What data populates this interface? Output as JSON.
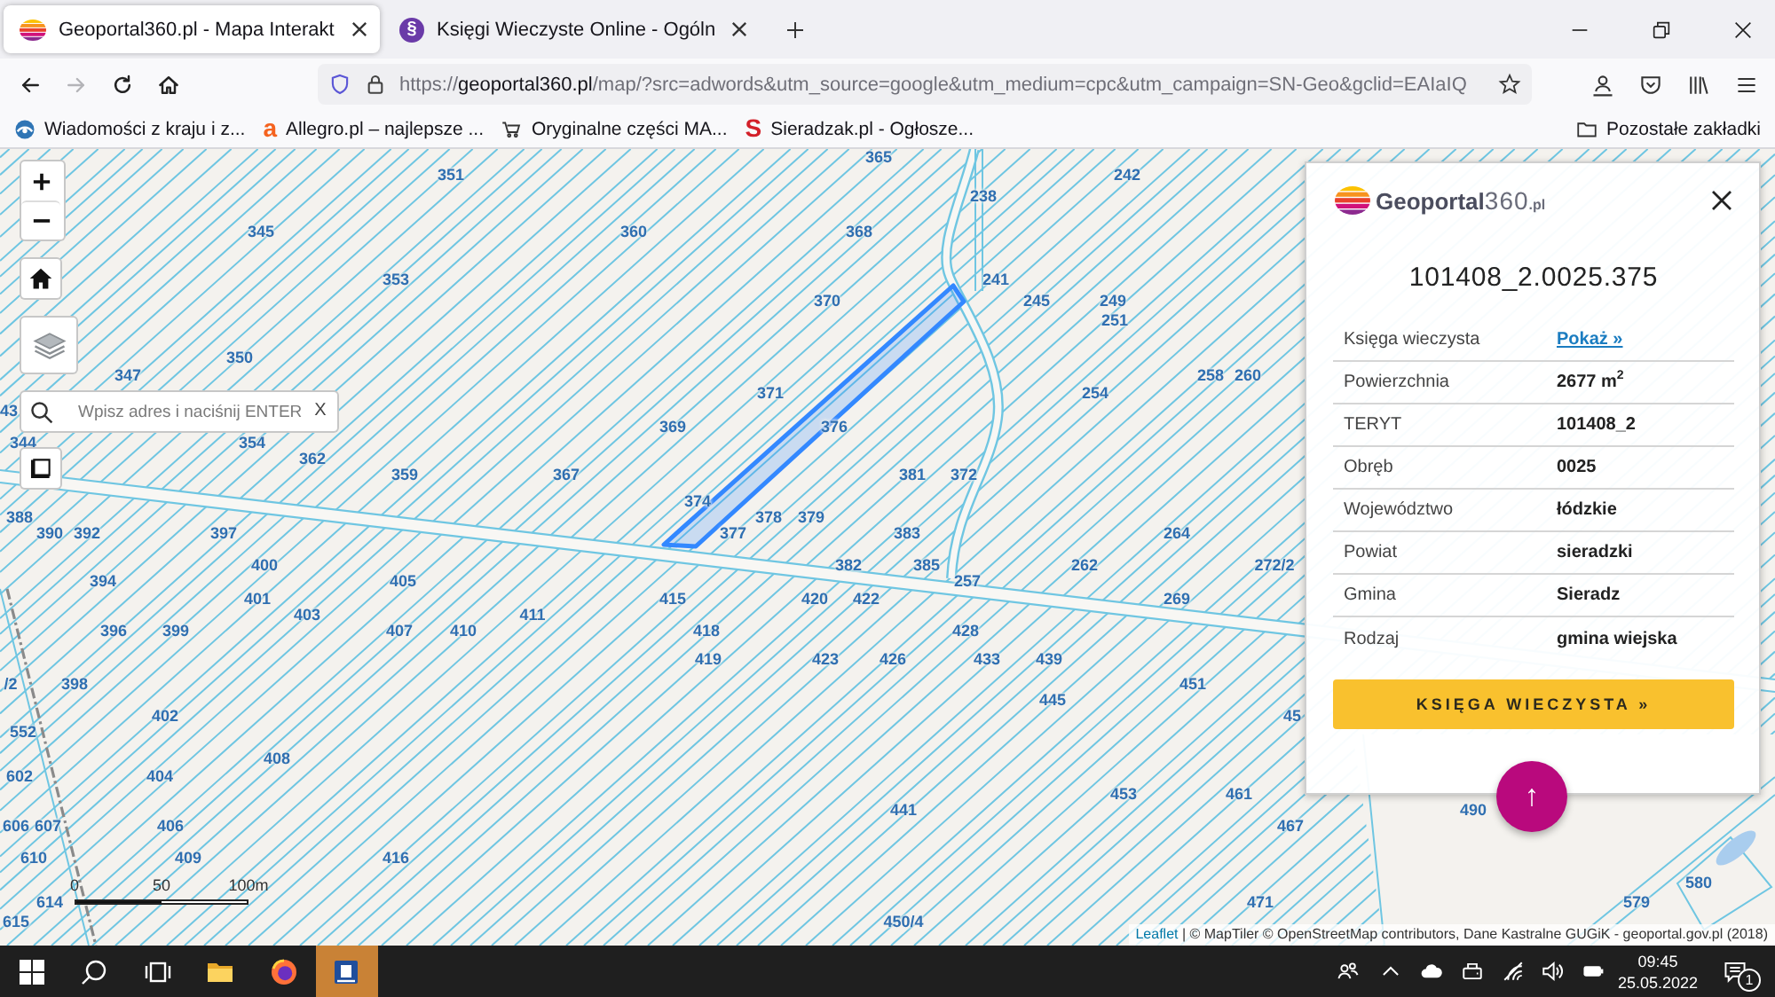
{
  "browser": {
    "tabs": [
      {
        "kind": "stripes",
        "title": "Geoportal360.pl - Mapa Interakt",
        "selected": true
      },
      {
        "kind": "letter",
        "favicon": "§",
        "title": "Księgi Wieczyste Online - Ogóln",
        "selected": false
      }
    ],
    "nav": [
      {
        "kind": "back",
        "disabled": false
      },
      {
        "kind": "forward",
        "disabled": true
      },
      {
        "kind": "reload",
        "disabled": false
      },
      {
        "kind": "home",
        "disabled": false
      }
    ],
    "url": {
      "scheme": "https://",
      "host": "geoportal360.pl",
      "path": "/map/?src=adwords&utm_source=google&utm_medium=cpc&utm_campaign=SN-Geo&gclid=EAIaIQ"
    },
    "bookmarks": [
      {
        "kind": "globe",
        "label": "Wiadomości z kraju i z..."
      },
      {
        "kind": "letter",
        "favicon": "a",
        "color": "#f5631f",
        "label": "Allegro.pl – najlepsze ..."
      },
      {
        "kind": "cart",
        "label": "Oryginalne części MA..."
      },
      {
        "kind": "letter",
        "favicon": "S",
        "color": "#d3202a",
        "label": "Sieradzak.pl - Ogłosze..."
      }
    ],
    "other_bookmarks": "Pozostałe zakładki"
  },
  "map": {
    "search": {
      "placeholder": "Wpisz adres i naciśnij ENTER",
      "clear": "X"
    },
    "parcel_numbers": [
      "365",
      "351",
      "242",
      "238",
      "345",
      "360",
      "368",
      "353",
      "241",
      "370",
      "245",
      "249",
      "251",
      "350",
      "347",
      "258",
      "260",
      "371",
      "254",
      "43",
      "369",
      "376",
      "344",
      "354",
      "362",
      "359",
      "367",
      "381",
      "372",
      "374",
      "388",
      "378",
      "379",
      "390",
      "392",
      "397",
      "377",
      "383",
      "264",
      "400",
      "382",
      "385",
      "262",
      "272/2",
      "394",
      "405",
      "257",
      "401",
      "415",
      "420",
      "422",
      "269",
      "403",
      "411",
      "396",
      "399",
      "407",
      "410",
      "418",
      "428",
      "419",
      "423",
      "426",
      "433",
      "439",
      "/2",
      "398",
      "451",
      "445",
      "402",
      "45",
      "552",
      "408",
      "602",
      "404",
      "453",
      "461",
      "441",
      "490",
      "606",
      "607",
      "406",
      "467",
      "610",
      "409",
      "416",
      "580",
      "614",
      "471",
      "579",
      "615",
      "450/4"
    ],
    "scale": [
      "0",
      "50",
      "100m"
    ],
    "attribution": {
      "link": "Leaflet",
      "text": "| © MapTiler © OpenStreetMap contributors, Dane Kastralne GUGiK - geoportal.gov.pl (2018)"
    }
  },
  "panel": {
    "logo": {
      "name": "Geoportal",
      "number": "360",
      "domain": ".pl"
    },
    "title": "101408_2.0025.375",
    "rows": [
      {
        "label": "Księga wieczysta",
        "value": "Pokaż »",
        "kind": "link"
      },
      {
        "label": "Powierzchnia",
        "value": "2677 m$^{2}$",
        "kind": "text"
      },
      {
        "label": "TERYT",
        "value": "101408_2",
        "kind": "text"
      },
      {
        "label": "Obręb",
        "value": "0025",
        "kind": "text"
      },
      {
        "label": "Województwo",
        "value": "łódzkie",
        "kind": "text"
      },
      {
        "label": "Powiat",
        "value": "sieradzki",
        "kind": "text"
      },
      {
        "label": "Gmina",
        "value": "Sieradz",
        "kind": "text"
      },
      {
        "label": "Rodzaj",
        "value": "gmina wiejska",
        "kind": "text"
      }
    ],
    "button": "KSIĘGA WIECZYSTA »",
    "scroll_up": "↑"
  },
  "taskbar": {
    "apps": [
      {
        "kind": "explorer",
        "attention": false
      },
      {
        "kind": "firefox",
        "attention": false
      },
      {
        "kind": "document",
        "attention": true
      }
    ],
    "time": "09:45",
    "date": "25.05.2022",
    "notifications": "1"
  }
}
